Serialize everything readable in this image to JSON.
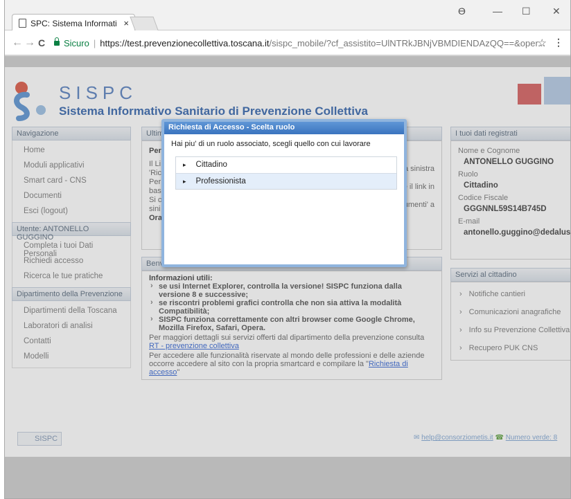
{
  "browser": {
    "tab_title": "SPC: Sistema Informati",
    "tab_close": "×",
    "win_controls": {
      "profile": "ϴ",
      "minimize": "—",
      "maximize": "☐",
      "close": "✕"
    },
    "nav": {
      "back": "←",
      "forward": "→",
      "reload": "C"
    },
    "secure_label": "Sicuro",
    "url_separator": "|",
    "url_host": "https://test.prevenzionecollettiva.toscana.it",
    "url_path": "/sispc_mobile/?cf_assistito=UlNTRkJBNjVBMDIENDAzQQ==&oper...",
    "star": "☆",
    "menu": "⋮"
  },
  "header": {
    "app_name": "SISPC",
    "app_subtitle": "Sistema Informativo Sanitario di Prevenzione Collettiva"
  },
  "nav": {
    "title": "Navigazione",
    "items": [
      "Home",
      "Moduli applicativi",
      "Smart card - CNS",
      "Documenti",
      "Esci (logout)"
    ],
    "user_title": "Utente: ANTONELLO GUGGINO",
    "user_items": [
      "Completa i tuoi Dati Personali",
      "Richiedi accesso",
      "Ricerca le tue pratiche"
    ],
    "dept_title": "Dipartimento della Prevenzione",
    "dept_items": [
      "Dipartimenti della Toscana",
      "Laboratori di analisi",
      "Contatti",
      "Modelli"
    ]
  },
  "main": {
    "box1_title": "Ultim",
    "box1_lines": [
      "Per",
      "Il Li",
      "'Ric",
      "Per",
      "bas",
      "Si c",
      "sini",
      "Ora"
    ],
    "box1_right": [
      "a sinistra",
      "e il link in",
      "umenti' a"
    ],
    "box2_title": "Benv",
    "info_title": "Informazioni utili:",
    "bullets": [
      "se usi Internet Explorer, controlla la versione! SISPC funziona dalla versione 8 e successive;",
      "se riscontri problemi grafici controlla che non sia attiva la modalità Compatibilità;",
      "SISPC funziona correttamente con altri browser come Google Chrome, Mozilla Firefox, Safari, Opera."
    ],
    "more_text": "Per maggiori dettagli sui servizi offerti dal dipartimento della prevenzione consulta ",
    "more_link": "RT - prevenzione collettiva",
    "access_text": "Per accedere alle funzionalità riservate al mondo delle professioni e delle aziende occorre accedere al sito con la propria smartcard e compilare la \"",
    "access_link": "Richiesta di accesso",
    "access_end": "\""
  },
  "side": {
    "reg_title": "I tuoi dati registrati",
    "name_label": "Nome e Cognome",
    "name_value": "ANTONELLO GUGGINO",
    "role_label": "Ruolo",
    "role_value": "Cittadino",
    "cf_label": "Codice Fiscale",
    "cf_value": "GGGNNL59S14B745D",
    "email_label": "E-mail",
    "email_value": "antonello.guggino@dedalus.eu",
    "serv_title": "Servizi al cittadino",
    "serv_items": [
      "Notifiche cantieri",
      "Comunicazioni anagrafiche",
      "Info su Prevenzione Collettiva",
      "Recupero PUK CNS"
    ]
  },
  "footer": {
    "tab_label": "SISPC",
    "help_link": "help@consorziometis.it",
    "phone_link": "Numero verde: 8"
  },
  "dialog": {
    "title": "Richiesta di Accesso - Scelta ruolo",
    "message": "Hai piu' di un ruolo associato, scegli quello con cui lavorare",
    "options": [
      "Cittadino",
      "Professionista"
    ],
    "selected": "Professionista"
  },
  "colors": {
    "dialog_title_bg": "#4a84c8",
    "link": "#4a76d8",
    "brand_blue": "#4a76b5"
  }
}
